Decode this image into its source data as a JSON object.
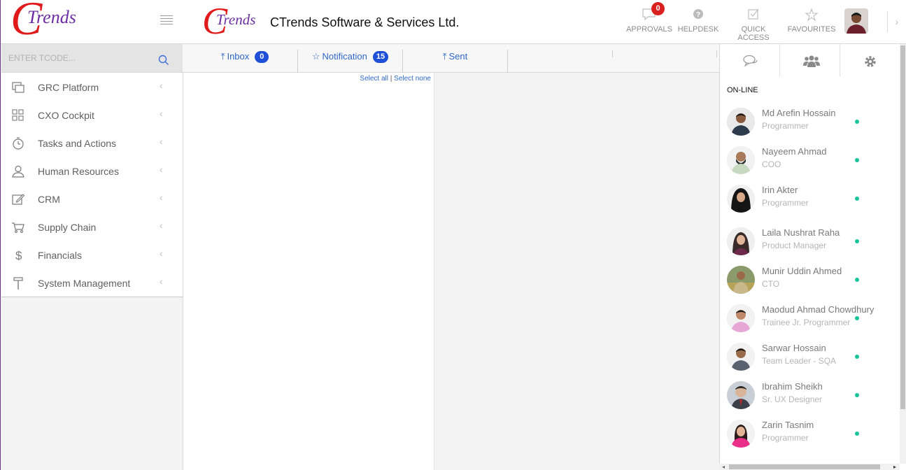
{
  "brand": {
    "logo_c": "C",
    "logo_rest": "Trends"
  },
  "tcode": {
    "placeholder": "ENTER TCODE..."
  },
  "sidebar": {
    "items": [
      {
        "label": "GRC Platform",
        "icon": "grc-icon"
      },
      {
        "label": "CXO Cockpit",
        "icon": "grid-icon"
      },
      {
        "label": "Tasks and Actions",
        "icon": "timer-icon"
      },
      {
        "label": "Human Resources",
        "icon": "user-icon"
      },
      {
        "label": "CRM",
        "icon": "edit-icon"
      },
      {
        "label": "Supply Chain",
        "icon": "cart-icon"
      },
      {
        "label": "Financials",
        "icon": "dollar-icon"
      },
      {
        "label": "System Management",
        "icon": "hammer-icon"
      }
    ]
  },
  "header": {
    "logo_c": "C",
    "logo_rest": "Trends",
    "company": "CTrends Software & Services Ltd.",
    "nav": [
      {
        "label": "APPROVALS",
        "icon": "comment-icon",
        "badge": "0"
      },
      {
        "label": "HELPDESK",
        "icon": "question-icon"
      },
      {
        "label": "QUICK ACCESS",
        "icon": "checkbox-icon"
      },
      {
        "label": "FAVOURITES",
        "icon": "star-icon"
      }
    ],
    "collapse": "›"
  },
  "tabs": [
    {
      "label": "Inbox",
      "count": "0",
      "icon": "upload-icon"
    },
    {
      "label": "Notification",
      "count": "15",
      "icon": "star-icon"
    },
    {
      "label": "Sent",
      "icon": "upload-icon"
    }
  ],
  "list": {
    "select_all": "Select all",
    "separator": "|",
    "select_none": "Select none"
  },
  "chat": {
    "online_title": "ON-LINE",
    "contacts": [
      {
        "name": "Md Arefin Hossain",
        "role": "Programmer"
      },
      {
        "name": "Nayeem Ahmad",
        "role": "COO"
      },
      {
        "name": "Irin Akter",
        "role": "Programmer"
      },
      {
        "name": "Laila Nushrat Raha",
        "role": "Product Manager"
      },
      {
        "name": "Munir Uddin Ahmed",
        "role": "CTO"
      },
      {
        "name": "Maodud Ahmad Chowdhury",
        "role": "Trainee Jr. Programmer"
      },
      {
        "name": "Sarwar Hossain",
        "role": "Team Leader - SQA"
      },
      {
        "name": "Ibrahim Sheikh",
        "role": "Sr. UX Designer"
      },
      {
        "name": "Zarin Tasnim",
        "role": "Programmer"
      }
    ]
  },
  "colors": {
    "accent_blue": "#1f4fd6",
    "link_blue": "#2f67c8",
    "badge_red": "#d9211f",
    "online_green": "#17c39a",
    "logo_red": "#e01a1a",
    "logo_purple": "#6a2ea2"
  }
}
